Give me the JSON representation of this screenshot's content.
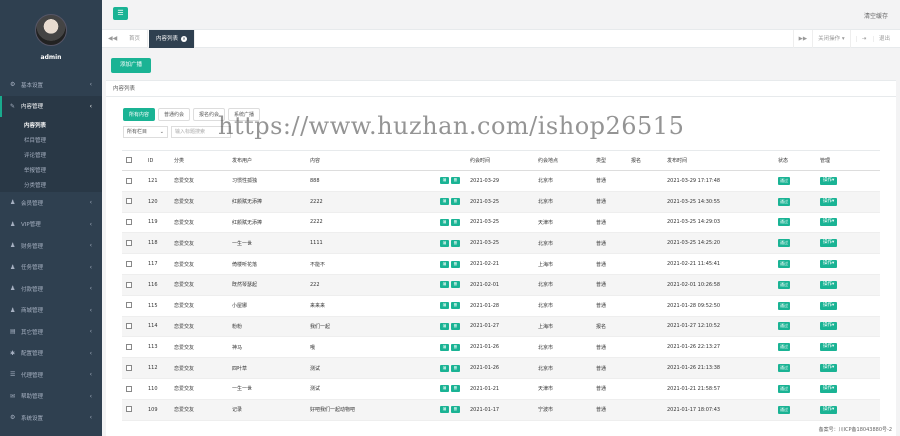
{
  "sidebar": {
    "user": "admin",
    "items": [
      {
        "label": "基本设置",
        "icon": "gear-icon",
        "glyph": "⚙"
      },
      {
        "label": "内容管理",
        "icon": "edit-icon",
        "glyph": "✎",
        "active": true,
        "sub": [
          "内容列表",
          "栏目管理",
          "评论管理",
          "举报管理",
          "分类管理"
        ]
      },
      {
        "label": "会员管理",
        "icon": "user-icon",
        "glyph": "♟"
      },
      {
        "label": "VIP管理",
        "icon": "user-icon",
        "glyph": "♟"
      },
      {
        "label": "财务管理",
        "icon": "user-icon",
        "glyph": "♟"
      },
      {
        "label": "任务管理",
        "icon": "user-icon",
        "glyph": "♟"
      },
      {
        "label": "付款管理",
        "icon": "user-icon",
        "glyph": "♟"
      },
      {
        "label": "商城管理",
        "icon": "user-icon",
        "glyph": "♟"
      },
      {
        "label": "其它管理",
        "icon": "folder-icon",
        "glyph": "▤"
      },
      {
        "label": "配置管理",
        "icon": "gear-icon",
        "glyph": "✱"
      },
      {
        "label": "代理管理",
        "icon": "list-icon",
        "glyph": "☰"
      },
      {
        "label": "帮助管理",
        "icon": "chat-icon",
        "glyph": "✉"
      },
      {
        "label": "系统设置",
        "icon": "gear-icon",
        "glyph": "⚙"
      }
    ]
  },
  "topbar": {
    "clear_cache": "清空缓存"
  },
  "tabs": {
    "home": "首页",
    "current": "内容列表",
    "close_ops": "关闭操作 ▾",
    "logout": "退出"
  },
  "content": {
    "add_button": "添加广播",
    "card_title": "内容列表",
    "filters": [
      "所有内容",
      "普通约会",
      "报名约会",
      "系统广播"
    ],
    "column_select": "所有栏目",
    "search_placeholder": "输入标题搜索"
  },
  "table": {
    "headers": [
      "",
      "ID",
      "分类",
      "发布用户",
      "内容",
      "",
      "约会时间",
      "约会地点",
      "类型",
      "报名",
      "发布时间",
      "状态",
      "管理"
    ],
    "edit_label": "编",
    "del_label": "删",
    "status_label": "通过",
    "op_label": "操作▾",
    "rows": [
      {
        "id": "121",
        "cat": "恋爱交友",
        "user": "习惯性孤独",
        "content": "888",
        "date": "2021-03-29",
        "place": "北京市",
        "type": "普通",
        "signup": "",
        "pub": "2021-03-29 17:17:48"
      },
      {
        "id": "120",
        "cat": "恋爱交友",
        "user": "红颜赋无添捧",
        "content": "2222",
        "date": "2021-03-25",
        "place": "北京市",
        "type": "普通",
        "signup": "",
        "pub": "2021-03-25 14:30:55"
      },
      {
        "id": "119",
        "cat": "恋爱交友",
        "user": "红颜赋无添捧",
        "content": "2222",
        "date": "2021-03-25",
        "place": "天津市",
        "type": "普通",
        "signup": "",
        "pub": "2021-03-25 14:29:03"
      },
      {
        "id": "118",
        "cat": "恋爱交友",
        "user": "一生一世",
        "content": "1111",
        "date": "2021-03-25",
        "place": "北京市",
        "type": "普通",
        "signup": "",
        "pub": "2021-03-25 14:25:20"
      },
      {
        "id": "117",
        "cat": "恋爱交友",
        "user": "倚楼听花落",
        "content": "不能不",
        "date": "2021-02-21",
        "place": "上海市",
        "type": "普通",
        "signup": "",
        "pub": "2021-02-21 11:45:41"
      },
      {
        "id": "116",
        "cat": "恋爱交友",
        "user": "既然琴瑟起",
        "content": "222",
        "date": "2021-02-01",
        "place": "北京市",
        "type": "普通",
        "signup": "",
        "pub": "2021-02-01 10:26:58"
      },
      {
        "id": "115",
        "cat": "恋爱交友",
        "user": "小屋娜",
        "content": "来来来",
        "date": "2021-01-28",
        "place": "北京市",
        "type": "普通",
        "signup": "",
        "pub": "2021-01-28 09:52:50"
      },
      {
        "id": "114",
        "cat": "恋爱交友",
        "user": "粉粉",
        "content": "我们一起",
        "date": "2021-01-27",
        "place": "上海市",
        "type": "报名",
        "signup": "",
        "pub": "2021-01-27 12:10:52"
      },
      {
        "id": "113",
        "cat": "恋爱交友",
        "user": "神马",
        "content": "哦",
        "date": "2021-01-26",
        "place": "北京市",
        "type": "普通",
        "signup": "",
        "pub": "2021-01-26 22:13:27"
      },
      {
        "id": "112",
        "cat": "恋爱交友",
        "user": "四叶草",
        "content": "测试",
        "date": "2021-01-26",
        "place": "北京市",
        "type": "普通",
        "signup": "",
        "pub": "2021-01-26 21:13:38"
      },
      {
        "id": "110",
        "cat": "恋爱交友",
        "user": "一生一世",
        "content": "测试",
        "date": "2021-01-21",
        "place": "天津市",
        "type": "普通",
        "signup": "",
        "pub": "2021-01-21 21:58:57"
      },
      {
        "id": "109",
        "cat": "恋爱交友",
        "user": "记录",
        "content": "好吧我们一起动物吧",
        "date": "2021-01-17",
        "place": "宁波市",
        "type": "普通",
        "signup": "",
        "pub": "2021-01-17 18:07:43"
      }
    ]
  },
  "watermark": "https://www.huzhan.com/ishop26515",
  "footer": "备案号：川ICP备18043880号-2"
}
